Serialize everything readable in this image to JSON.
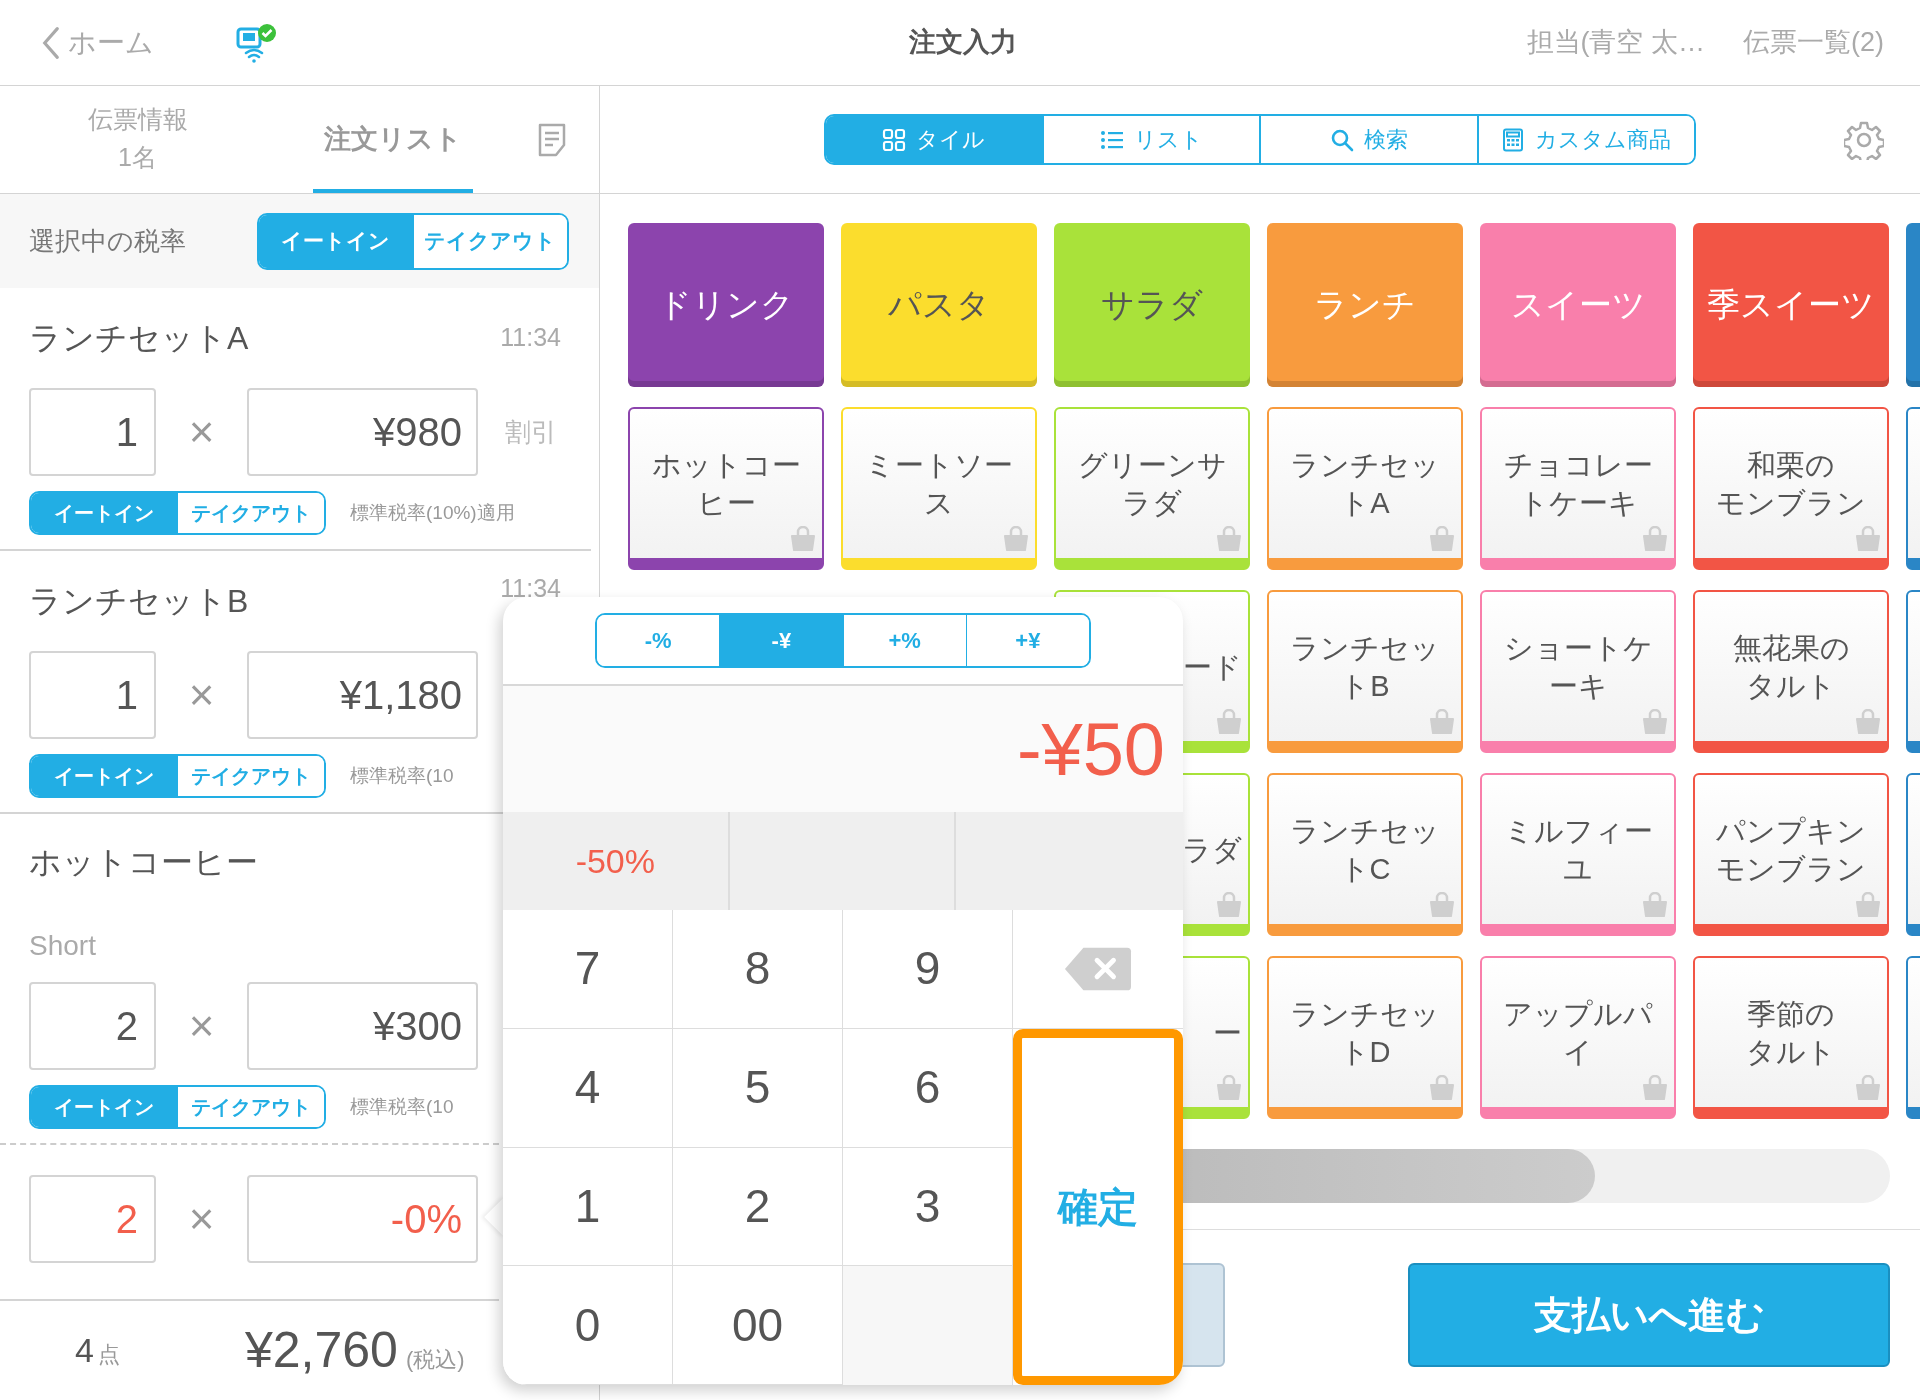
{
  "header": {
    "back": "ホーム",
    "title": "注文入力",
    "staff": "担当(青空 太…",
    "slips": "伝票一覧(2)"
  },
  "left": {
    "tabs": [
      {
        "label": "伝票情報",
        "sublabel": "1名",
        "selected": false
      },
      {
        "label": "注文リスト",
        "selected": true
      }
    ],
    "tax_rate": {
      "label": "選択中の税率",
      "options": [
        {
          "label": "イートイン",
          "selected": true
        },
        {
          "label": "テイクアウト",
          "selected": false
        }
      ]
    },
    "items": [
      {
        "name": "ランチセットA",
        "time": "11:34",
        "qty": "1",
        "times": "×",
        "price": "¥980",
        "discount": "割引",
        "options": [
          {
            "label": "イートイン",
            "selected": true
          },
          {
            "label": "テイクアウト",
            "selected": false
          }
        ],
        "tax_note": "標準税率(10%)適用"
      },
      {
        "name": "ランチセットB",
        "time": "11:34",
        "qty": "1",
        "times": "×",
        "price": "¥1,180",
        "options": [
          {
            "label": "イートイン",
            "selected": true
          },
          {
            "label": "テイクアウト",
            "selected": false
          }
        ],
        "tax_note": "標準税率(10"
      },
      {
        "name": "ホットコーヒー",
        "variant": "Short",
        "qty": "2",
        "times": "×",
        "price": "¥300",
        "options": [
          {
            "label": "イートイン",
            "selected": true
          },
          {
            "label": "テイクアウト",
            "selected": false
          }
        ],
        "tax_note": "標準税率(10"
      }
    ],
    "discount_row": {
      "qty": "2",
      "times": "×",
      "value": "-0%"
    },
    "footer": {
      "count": "4",
      "unit": "点",
      "total": "¥2,760",
      "tax": "(税込)"
    }
  },
  "right": {
    "view_tabs": [
      {
        "label": "タイル",
        "selected": true
      },
      {
        "label": "リスト",
        "selected": false
      },
      {
        "label": "検索",
        "selected": false
      },
      {
        "label": "カスタム商品",
        "selected": false
      }
    ],
    "categories": [
      {
        "label": "ドリンク",
        "color": "#8c44ad"
      },
      {
        "label": "パスタ",
        "color": "#fbdd2d"
      },
      {
        "label": "サラダ",
        "color": "#a9e23a"
      },
      {
        "label": "ランチ",
        "color": "#f89b3e"
      },
      {
        "label": "スイーツ",
        "color": "#f97fab"
      },
      {
        "label": "季スイーツ",
        "color": "#f25545"
      },
      {
        "color": "#2a86c6"
      }
    ],
    "products": [
      [
        {
          "kind": "product",
          "label": "ホットコーヒー",
          "color": "#8c44ad"
        },
        {
          "kind": "product",
          "label": "ミートソース",
          "color": "#fbdd2d"
        },
        {
          "kind": "product",
          "label": "グリーンサラダ",
          "color": "#a9e23a"
        },
        {
          "kind": "product",
          "label": "ランチセットA",
          "color": "#f89b3e"
        },
        {
          "kind": "product",
          "label": "チョコレートケーキ",
          "color": "#f97fab"
        },
        {
          "kind": "product",
          "label": "和栗のモンブラン",
          "color": "#f25545"
        },
        {
          "kind": "edge",
          "color": "#2a86c6"
        }
      ],
      [
        {
          "kind": "covered",
          "label": "ード",
          "color": "#a9e23a"
        },
        {
          "kind": "product",
          "label": "ランチセットB",
          "color": "#f89b3e"
        },
        {
          "kind": "product",
          "label": "ショートケーキ",
          "color": "#f97fab"
        },
        {
          "kind": "product",
          "label": "無花果のタルト",
          "color": "#f25545"
        },
        {
          "kind": "edge",
          "color": "#2a86c6"
        }
      ],
      [
        {
          "kind": "covered",
          "label": "ラダ",
          "color": "#a9e23a"
        },
        {
          "kind": "product",
          "label": "ランチセットC",
          "color": "#f89b3e"
        },
        {
          "kind": "product",
          "label": "ミルフィーユ",
          "color": "#f97fab"
        },
        {
          "kind": "product",
          "label": "パンプキンモンブラン",
          "color": "#f25545"
        },
        {
          "kind": "edge",
          "color": "#2a86c6"
        }
      ],
      [
        {
          "kind": "covered",
          "label": "ー",
          "color": "#a9e23a"
        },
        {
          "kind": "product",
          "label": "ランチセットD",
          "color": "#f89b3e"
        },
        {
          "kind": "product",
          "label": "アップルパイ",
          "color": "#f97fab"
        },
        {
          "kind": "product",
          "label": "季節のタルト",
          "color": "#f25545"
        },
        {
          "kind": "edge",
          "color": "#2a86c6"
        }
      ]
    ],
    "pay_button": "支払いへ進む"
  },
  "keypad": {
    "modes": [
      {
        "label": "-%",
        "selected": false
      },
      {
        "label": "-¥",
        "selected": true
      },
      {
        "label": "+%",
        "selected": false
      },
      {
        "label": "+¥",
        "selected": false
      }
    ],
    "display": "-¥50",
    "presets": [
      {
        "label": "-50%"
      }
    ],
    "keys": [
      {
        "kind": "digit",
        "label": "7"
      },
      {
        "kind": "digit",
        "label": "8"
      },
      {
        "kind": "digit",
        "label": "9"
      },
      {
        "kind": "backspace"
      },
      {
        "kind": "digit",
        "label": "4"
      },
      {
        "kind": "digit",
        "label": "5"
      },
      {
        "kind": "digit",
        "label": "6"
      },
      {
        "kind": "digit",
        "label": "1"
      },
      {
        "kind": "digit",
        "label": "2"
      },
      {
        "kind": "digit",
        "label": "3"
      },
      {
        "kind": "confirm",
        "label": "確定",
        "highlighted": true
      },
      {
        "kind": "digit",
        "label": "0"
      },
      {
        "kind": "digit",
        "label": "00"
      },
      {
        "kind": "blank"
      }
    ]
  }
}
